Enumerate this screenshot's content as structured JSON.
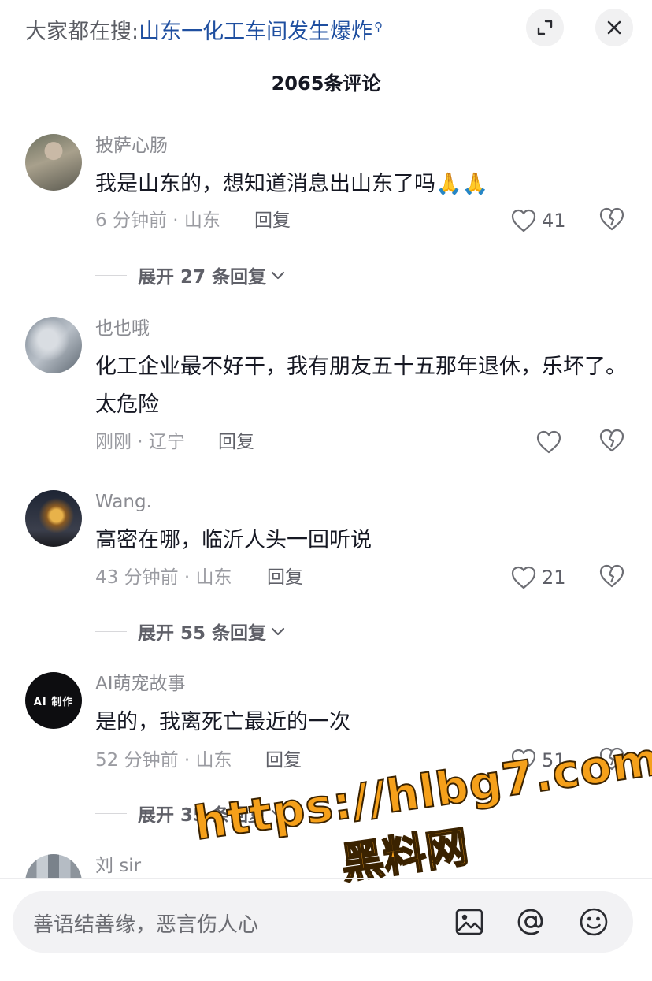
{
  "header": {
    "search_prefix": "大家都在搜:",
    "search_query": "山东一化工车间发生爆炸",
    "expand_icon": "expand-icon",
    "close_icon": "close-icon",
    "comment_count_title": "2065条评论"
  },
  "comments": [
    {
      "username": "披萨心肠",
      "content": "我是山东的，想知道消息出山东了吗🙏🙏",
      "meta": "6 分钟前 · 山东",
      "reply_label": "回复",
      "like_count": "41",
      "expand_label": "展开 27 条回复"
    },
    {
      "username": "也也哦",
      "content": "化工企业最不好干，我有朋友五十五那年退休，乐坏了。太危险",
      "meta": "刚刚 · 辽宁",
      "reply_label": "回复",
      "like_count": ""
    },
    {
      "username": "Wang.",
      "content": "高密在哪，临沂人头一回听说",
      "meta": "43 分钟前 · 山东",
      "reply_label": "回复",
      "like_count": "21",
      "expand_label": "展开 55 条回复"
    },
    {
      "username": "AI萌宠故事",
      "avatar_text": "AI 制作",
      "content": "是的，我离死亡最近的一次",
      "meta": "52 分钟前 · 山东",
      "reply_label": "回复",
      "like_count": "51",
      "expand_label": "展开 35 条回复"
    },
    {
      "username": "刘 sir"
    }
  ],
  "input": {
    "placeholder": "善语结善缘，恶言伤人心",
    "icons": [
      "image-icon",
      "at-icon",
      "emoji-icon"
    ]
  },
  "watermark": {
    "url": "https://hlbg7.com",
    "name": "黑料网"
  },
  "colors": {
    "link": "#1f4fa0",
    "text": "#161823",
    "muted": "#9a9ba1",
    "watermark": "#f5a01a"
  }
}
